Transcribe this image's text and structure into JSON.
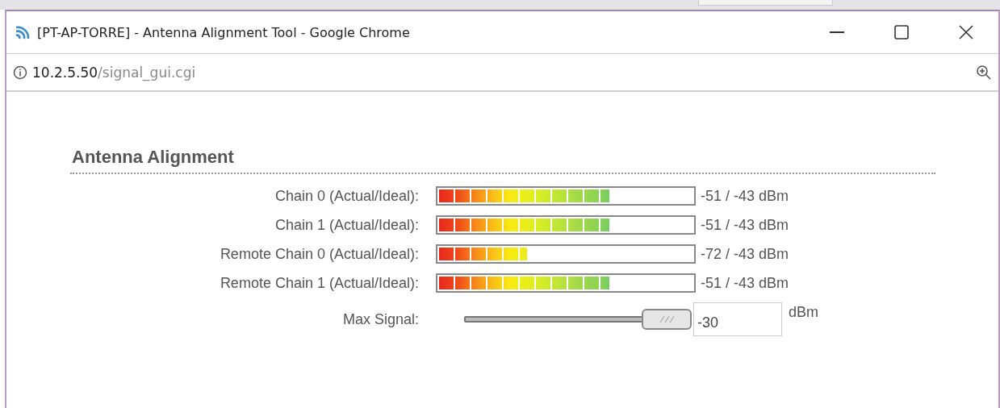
{
  "window": {
    "title": "[PT-AP-TORRE] - Antenna Alignment Tool - Google Chrome"
  },
  "address_bar": {
    "host": "10.2.5.50",
    "path": "/signal_gui.cgi"
  },
  "section": {
    "title": "Antenna Alignment"
  },
  "meters": [
    {
      "label": "Chain 0 (Actual/Ideal):",
      "level": 0.67,
      "reading": "-51 / -43 dBm"
    },
    {
      "label": "Chain 1 (Actual/Ideal):",
      "level": 0.67,
      "reading": "-51 / -43 dBm"
    },
    {
      "label": "Remote Chain 0 (Actual/Ideal):",
      "level": 0.35,
      "reading": "-72 / -43 dBm"
    },
    {
      "label": "Remote Chain 1 (Actual/Ideal):",
      "level": 0.67,
      "reading": "-51 / -43 dBm"
    }
  ],
  "max_signal": {
    "label": "Max Signal:",
    "level": 1,
    "value": "-30",
    "unit": "dBm"
  }
}
